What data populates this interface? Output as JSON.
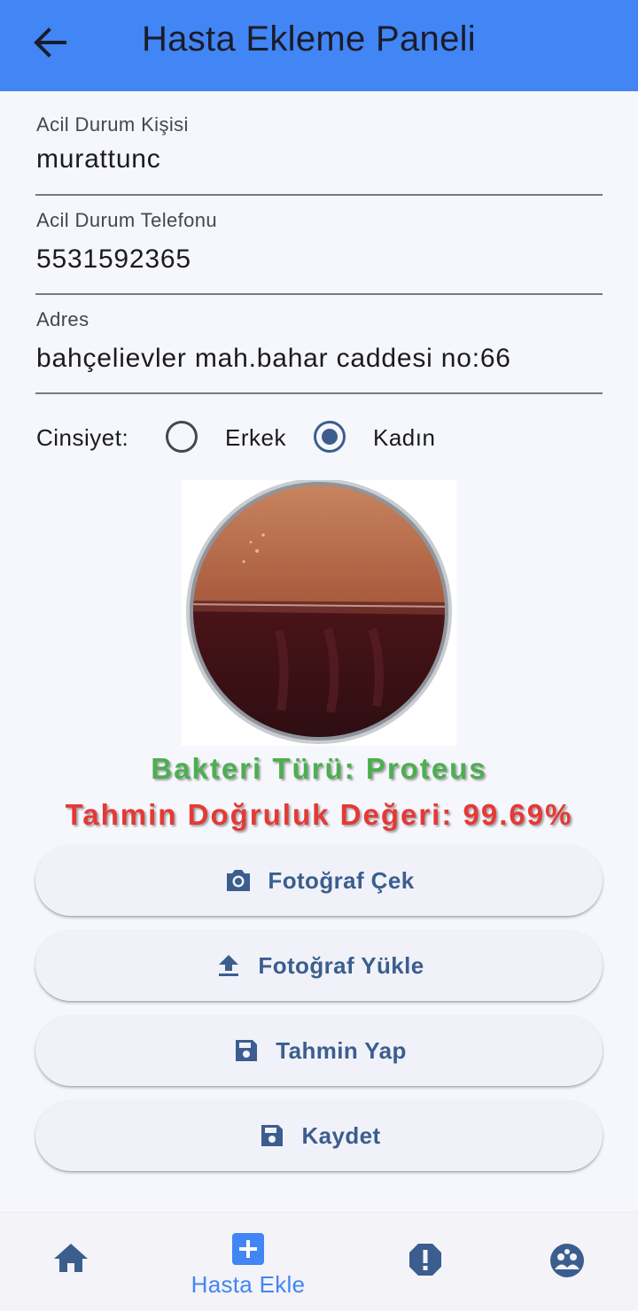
{
  "appbar": {
    "title": "Hasta Ekleme Paneli",
    "back_icon": "arrow-left-icon"
  },
  "form": {
    "emergency_contact": {
      "label": "Acil Durum Kişisi",
      "value": "murattunc"
    },
    "emergency_phone": {
      "label": "Acil Durum Telefonu",
      "value": "5531592365"
    },
    "address": {
      "label": "Adres",
      "value": "bahçelievler mah.bahar caddesi no:66"
    },
    "gender": {
      "label": "Cinsiyet:",
      "options": [
        "Erkek",
        "Kadın"
      ],
      "selected": "Kadın"
    }
  },
  "result": {
    "bacteria": "Bakteri Türü: Proteus",
    "accuracy": "Tahmin Doğruluk Değeri: 99.69%"
  },
  "buttons": {
    "take_photo": "Fotoğraf Çek",
    "upload_photo": "Fotoğraf Yükle",
    "predict": "Tahmin Yap",
    "save": "Kaydet"
  },
  "nav": {
    "items": [
      {
        "icon": "home-icon",
        "label": ""
      },
      {
        "icon": "add-box-icon",
        "label": "Hasta Ekle",
        "active": true
      },
      {
        "icon": "alert-icon",
        "label": ""
      },
      {
        "icon": "group-icon",
        "label": ""
      }
    ]
  },
  "colors": {
    "appbar": "#4285f4",
    "accent": "#3b5e8f",
    "result_green": "#4caf50",
    "result_red": "#e53935"
  }
}
